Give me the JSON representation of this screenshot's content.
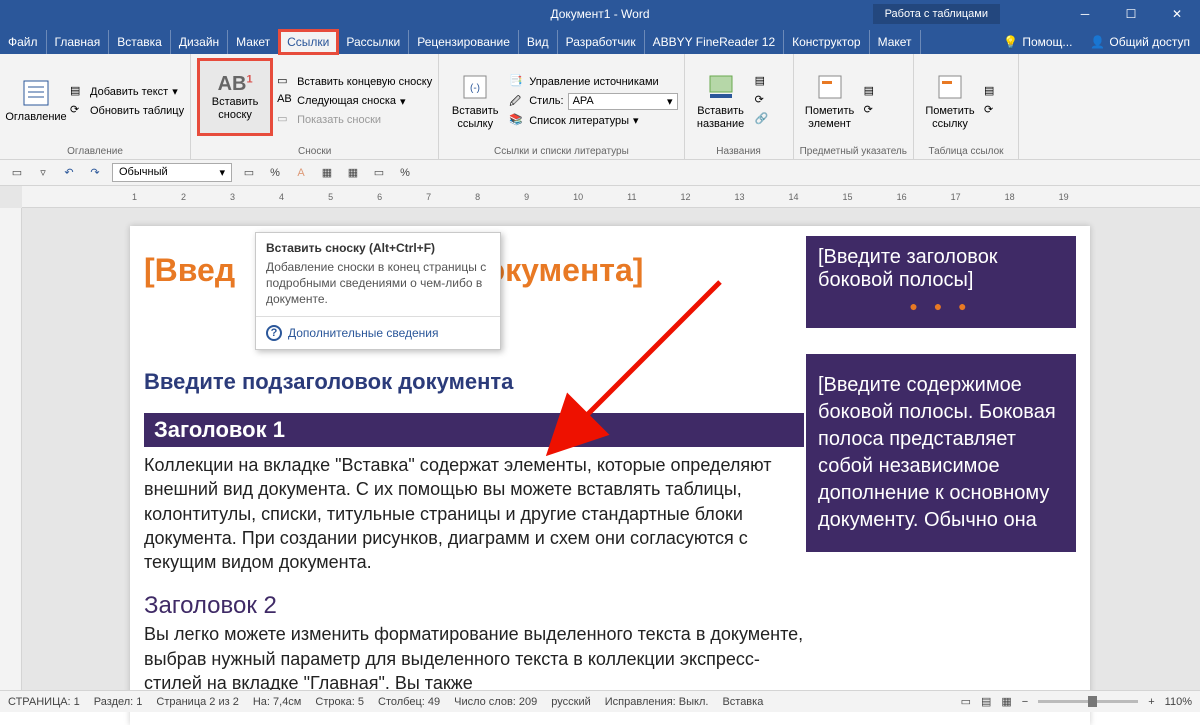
{
  "titlebar": {
    "title": "Документ1 - Word",
    "table_tools": "Работа с таблицами"
  },
  "tabs": {
    "items": [
      "Файл",
      "Главная",
      "Вставка",
      "Дизайн",
      "Макет",
      "Ссылки",
      "Рассылки",
      "Рецензирование",
      "Вид",
      "Разработчик",
      "ABBYY FineReader 12",
      "Конструктор",
      "Макет"
    ],
    "help": "Помощ...",
    "share": "Общий доступ"
  },
  "ribbon": {
    "toc": {
      "big": "Оглавление",
      "add_text": "Добавить текст",
      "update": "Обновить таблицу",
      "group": "Оглавление"
    },
    "footnotes": {
      "insert": "Вставить сноску",
      "end": "Вставить концевую сноску",
      "next": "Следующая сноска",
      "show": "Показать сноски",
      "group": "Сноски"
    },
    "citations": {
      "big": "Вставить ссылку",
      "manage": "Управление источниками",
      "style_label": "Стиль:",
      "style_value": "APA",
      "biblio": "Список литературы",
      "group": "Ссылки и списки литературы"
    },
    "captions": {
      "big": "Вставить название",
      "group": "Названия"
    },
    "index": {
      "big": "Пометить элемент",
      "group": "Предметный указатель"
    },
    "auth": {
      "big": "Пометить ссылку",
      "group": "Таблица ссылок"
    }
  },
  "quickbar": {
    "style": "Обычный"
  },
  "ruler": [
    "1",
    "2",
    "3",
    "4",
    "5",
    "6",
    "7",
    "8",
    "9",
    "10",
    "11",
    "12",
    "13",
    "14",
    "15",
    "16",
    "17",
    "18",
    "19"
  ],
  "tooltip": {
    "title": "Вставить сноску (Alt+Ctrl+F)",
    "body": "Добавление сноски в конец страницы с подробными сведениями о чем-либо в документе.",
    "more": "Дополнительные сведения"
  },
  "doc": {
    "title": "[Введите заголовок документа]",
    "title_vis_left": "[Введ",
    "title_vis_right": "вок документа]",
    "subtitle": "Введите подзаголовок документа",
    "h1": "Заголовок 1",
    "p1": "Коллекции на вкладке \"Вставка\" содержат элементы, которые определяют внешний вид документа. С их помощью вы можете вставлять таблицы, колонтитулы, списки, титульные страницы и другие стандартные блоки документа. При создании рисунков, диаграмм и схем они согласуются с текущим видом документа.",
    "h2": "Заголовок 2",
    "p2": "Вы легко можете изменить форматирование выделенного текста в документе, выбрав нужный параметр для выделенного текста в коллекции экспресс-стилей на вкладке \"Главная\". Вы также",
    "sidebar_head": "[Введите заголовок боковой полосы]",
    "sidebar_body": "[Введите содержимое боковой полосы. Боковая полоса представляет собой независимое дополнение к основному документу. Обычно она"
  },
  "status": {
    "page": "СТРАНИЦА: 1",
    "section": "Раздел: 1",
    "pages": "Страница 2 из 2",
    "pos": "На: 7,4см",
    "line": "Строка: 5",
    "col": "Столбец: 49",
    "words": "Число слов: 209",
    "lang": "русский",
    "track": "Исправления: Выкл.",
    "mode": "Вставка",
    "zoom": "110%"
  }
}
